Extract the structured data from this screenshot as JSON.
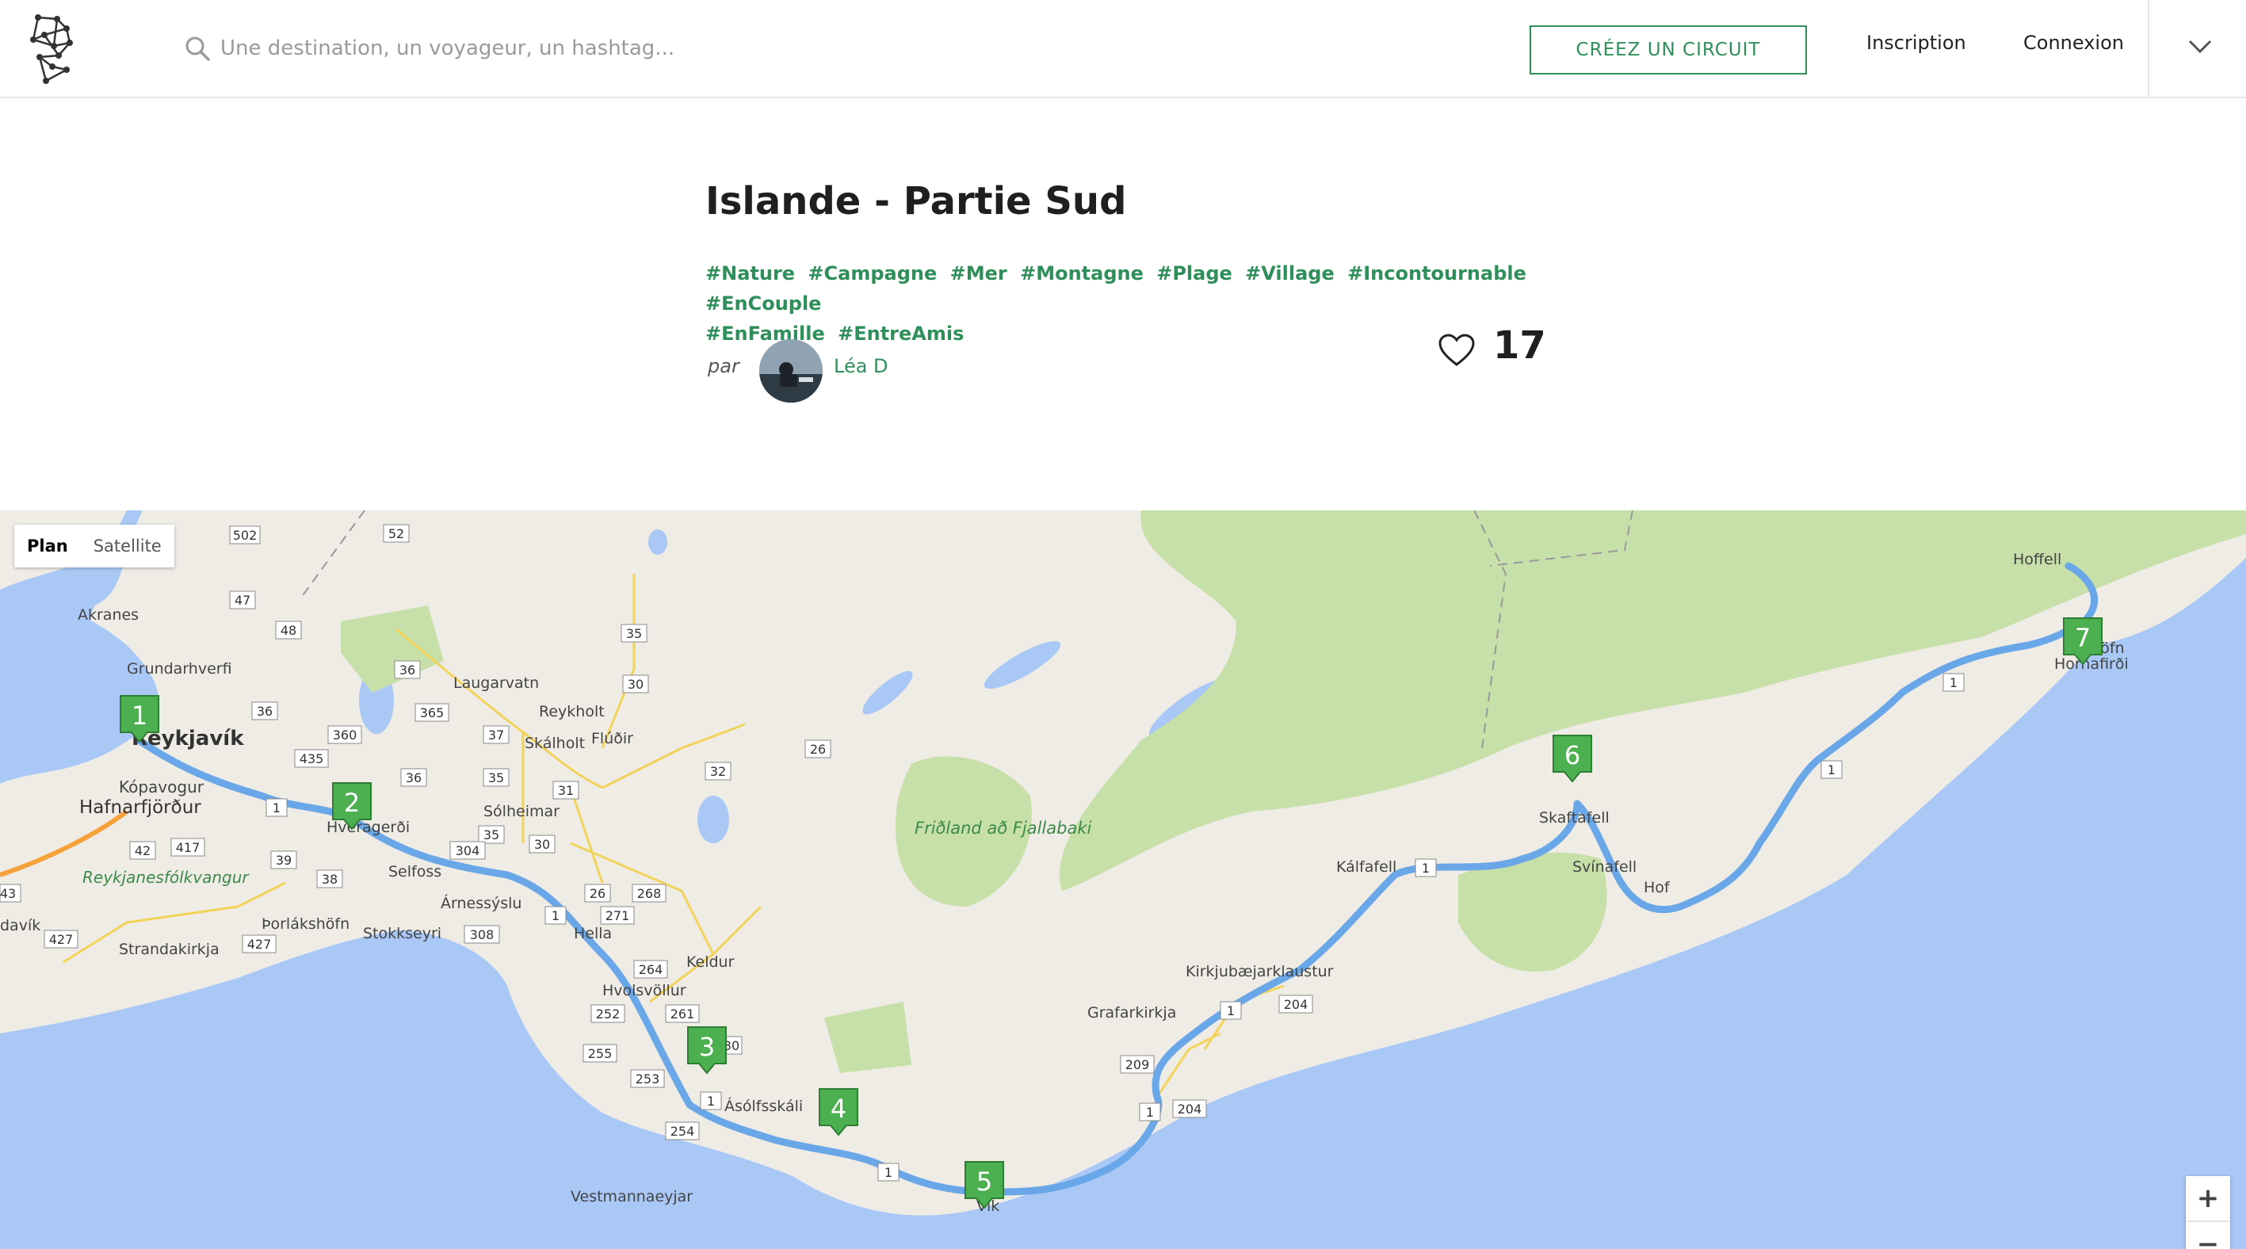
{
  "header": {
    "search_placeholder": "Une destination, un voyageur, un hashtag...",
    "create_label": "CRÉEZ UN CIRCUIT",
    "inscription_label": "Inscription",
    "connexion_label": "Connexion"
  },
  "circuit": {
    "title": "Islande - Partie Sud",
    "tags": [
      "#Nature",
      "#Campagne",
      "#Mer",
      "#Montagne",
      "#Plage",
      "#Village",
      "#Incontournable",
      "#EnCouple",
      "#EnFamille",
      "#EntreAmis"
    ],
    "by_label": "par",
    "author": "Léa D",
    "likes": "17"
  },
  "map": {
    "type_plan": "Plan",
    "type_satellite": "Satellite",
    "zoom_in": "+",
    "zoom_out": "−",
    "colors": {
      "water": "#a9c8f6",
      "land": "#efece6",
      "park": "#c7dfa8",
      "route": "#6aa7e8",
      "marker": "#4caf50"
    },
    "places": [
      {
        "name": "Reykjavík"
      },
      {
        "name": "Kópavogur"
      },
      {
        "name": "Hafnarfjörður"
      },
      {
        "name": "Akranes"
      },
      {
        "name": "Grundarhverfi"
      },
      {
        "name": "Hveragerði"
      },
      {
        "name": "Selfoss"
      },
      {
        "name": "Árnessýslu"
      },
      {
        "name": "Stokkseyri"
      },
      {
        "name": "Þorlákshöfn"
      },
      {
        "name": "Strandakirkja"
      },
      {
        "name": "Reykjanesfólkvangur"
      },
      {
        "name": "Laugarvatn"
      },
      {
        "name": "Reykholt"
      },
      {
        "name": "Skálholt"
      },
      {
        "name": "Flúðir"
      },
      {
        "name": "Sólheimar"
      },
      {
        "name": "Hella"
      },
      {
        "name": "Hvolsvöllur"
      },
      {
        "name": "Keldur"
      },
      {
        "name": "Ásólfsskáli"
      },
      {
        "name": "Vestmannaeyjar"
      },
      {
        "name": "Vík"
      },
      {
        "name": "Friðland að Fjallabaki"
      },
      {
        "name": "Grafarkirkja"
      },
      {
        "name": "Kirkjubæjarklaustur"
      },
      {
        "name": "Kálfafell"
      },
      {
        "name": "Skaftafell"
      },
      {
        "name": "Svínafell"
      },
      {
        "name": "Hof"
      },
      {
        "name": "Höfn"
      },
      {
        "name": "Hornafirði"
      },
      {
        "name": "Hoffell"
      },
      {
        "name": "davík"
      }
    ],
    "roads": [
      "502",
      "52",
      "47",
      "48",
      "36",
      "36",
      "365",
      "360",
      "435",
      "36",
      "35",
      "35",
      "37",
      "31",
      "30",
      "35",
      "30",
      "26",
      "32",
      "26",
      "268",
      "271",
      "304",
      "308",
      "39",
      "38",
      "42",
      "417",
      "427",
      "427",
      "43",
      "1",
      "1",
      "1",
      "1",
      "1",
      "1",
      "1",
      "1",
      "1",
      "264",
      "261",
      "252",
      "255",
      "253",
      "254",
      "30",
      "209",
      "204",
      "204"
    ],
    "markers": [
      "1",
      "2",
      "3",
      "4",
      "5",
      "6",
      "7"
    ]
  }
}
